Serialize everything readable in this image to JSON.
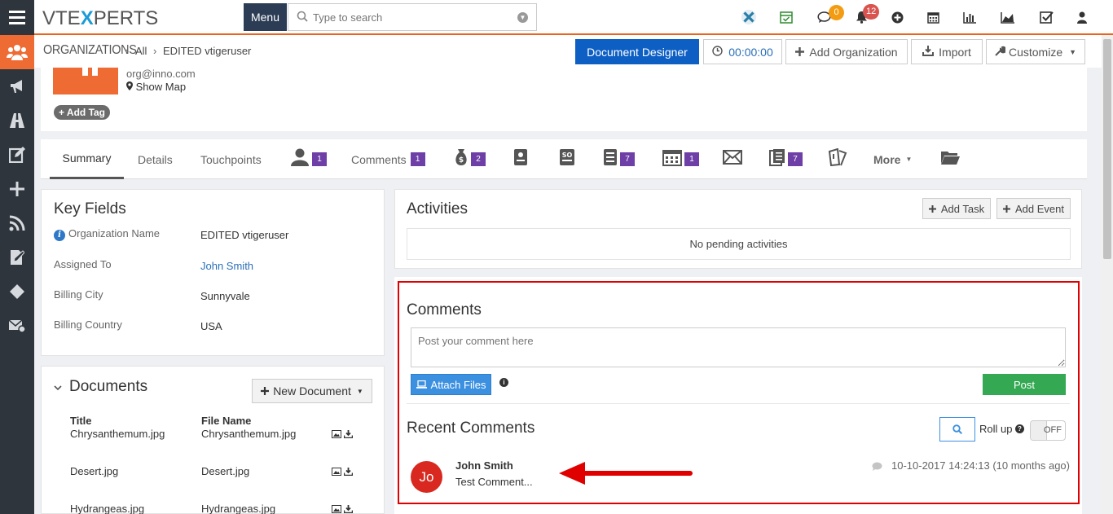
{
  "topbar": {
    "logo": "VTEXPERTS",
    "logo_left": "VTE",
    "logo_x": "X",
    "logo_right": "PERTS",
    "menu_label": "Menu",
    "search_placeholder": "Type to search",
    "chat_badge": "0",
    "notif_badge": "12",
    "icons": [
      "vtiger-x-icon",
      "calendar-check-icon",
      "chat-icon",
      "bell-icon",
      "plus-circle-icon",
      "calendar-icon",
      "bar-chart-icon",
      "area-chart-icon",
      "checkbox-icon",
      "user-icon"
    ],
    "colors": {
      "accent": "#e8651f",
      "badge_orange": "#f39c12",
      "badge_red": "#d9534f",
      "primary": "#0d5fc4"
    }
  },
  "sidebar": {
    "items": [
      "organizations-icon",
      "megaphone-icon",
      "road-icon",
      "edit-icon",
      "plus-icon",
      "rss-icon",
      "document-edit-icon",
      "diamond-icon",
      "mail-settings-icon"
    ]
  },
  "header": {
    "module": "ORGANIZATIONS",
    "crumb_all": "All",
    "crumb_record": "EDITED vtigeruser",
    "btn_document_designer": "Document Designer",
    "btn_timer": "00:00:00",
    "btn_add_org": "Add Organization",
    "btn_import": "Import",
    "btn_customize": "Customize"
  },
  "record": {
    "email": "org@inno.com",
    "show_map": "Show Map",
    "add_tag": "Add Tag"
  },
  "tabs": {
    "summary": "Summary",
    "details": "Details",
    "touchpoints": "Touchpoints",
    "contacts_count": "1",
    "comments": "Comments",
    "comments_count": "1",
    "deals_count": "2",
    "invoices_count": "7",
    "events_count": "1",
    "documents_count": "7",
    "more": "More"
  },
  "key_fields": {
    "title": "Key Fields",
    "rows": [
      {
        "label": "Organization Name",
        "value": "EDITED vtigeruser"
      },
      {
        "label": "Assigned To",
        "value": "John Smith"
      },
      {
        "label": "Billing City",
        "value": "Sunnyvale"
      },
      {
        "label": "Billing Country",
        "value": "USA"
      }
    ]
  },
  "documents": {
    "title": "Documents",
    "new_doc": "New Document",
    "col_title": "Title",
    "col_file": "File Name",
    "rows": [
      {
        "title": "Chrysanthemum.jpg",
        "file": "Chrysanthemum.jpg"
      },
      {
        "title": "Desert.jpg",
        "file": "Desert.jpg"
      },
      {
        "title": "Hydrangeas.jpg",
        "file": "Hydrangeas.jpg"
      }
    ]
  },
  "activities": {
    "title": "Activities",
    "add_task": "Add Task",
    "add_event": "Add Event",
    "empty": "No pending activities"
  },
  "comments": {
    "title": "Comments",
    "placeholder": "Post your comment here",
    "attach": "Attach Files",
    "post": "Post",
    "recent_title": "Recent Comments",
    "roll_up": "Roll up",
    "toggle": "OFF",
    "items": [
      {
        "avatar": "Jo",
        "author": "John Smith",
        "text": "Test Comment...",
        "time": "10-10-2017 14:24:13 (10 months ago)"
      }
    ]
  }
}
